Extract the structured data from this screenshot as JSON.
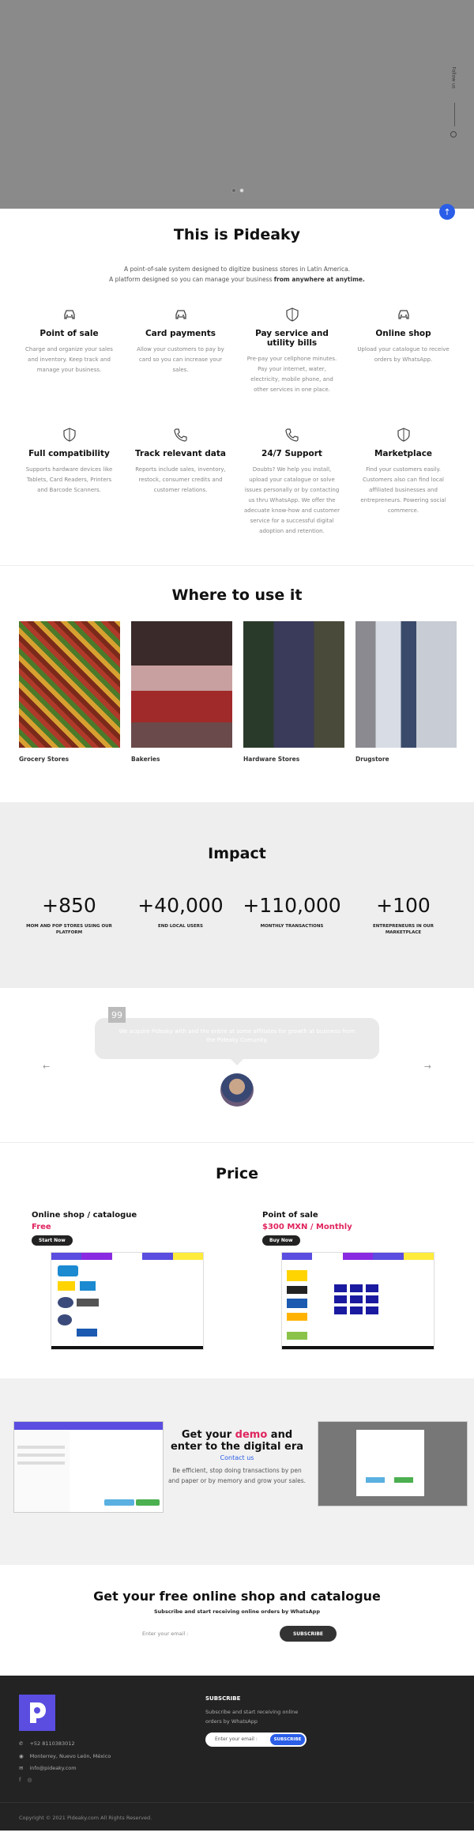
{
  "hero": {
    "follow_label": "Follow us",
    "slides": 2,
    "active_slide": 1
  },
  "about": {
    "title": "This is Pideaky",
    "line1": "A point-of-sale system designed to digitize business stores in Latin America.",
    "line2_prefix": "A platform designed so you can manage your business ",
    "line2_bold": "from anywhere at anytime.",
    "features": [
      {
        "icon": "car-icon",
        "title": "Point of sale",
        "desc": "Charge and organize your sales and inventory. Keep track and manage your business."
      },
      {
        "icon": "car-icon",
        "title": "Card payments",
        "desc": "Allow your customers to pay by card so you can increase your sales."
      },
      {
        "icon": "shield-icon",
        "title": "Pay service and utility bills",
        "desc": "Pre-pay your cellphone minutes. Pay your internet, water, electricity, mobile phone, and other services in one place."
      },
      {
        "icon": "car-icon",
        "title": "Online shop",
        "desc": "Upload your catalogue to receive orders by WhatsApp."
      },
      {
        "icon": "shield-icon",
        "title": "Full compatibility",
        "desc": "Supports hardware devices like Tablets, Card Readers, Printers and Barcode Scanners."
      },
      {
        "icon": "phone-icon",
        "title": "Track relevant data",
        "desc": "Reports include sales, inventory, restock, consumer credits and customer relations."
      },
      {
        "icon": "phone-icon",
        "title": "24/7 Support",
        "desc": "Doubts? We help you install, upload your catalogue or solve issues personally or by contacting us thru WhatsApp. We offer the adecuate know-how and customer service for a successful digital adoption and retention."
      },
      {
        "icon": "shield-icon",
        "title": "Marketplace",
        "desc": "Find your customers easily. Customers also can find local affiliated businesses and entrepreneurs. Powering social commerce."
      }
    ]
  },
  "where": {
    "title": "Where to use it",
    "items": [
      {
        "label": "Grocery Stores"
      },
      {
        "label": "Bakeries"
      },
      {
        "label": "Hardware Stores"
      },
      {
        "label": "Drugstore"
      }
    ]
  },
  "impact": {
    "title": "Impact",
    "stats": [
      {
        "num": "+850",
        "label": "MOM AND POP STORES USING OUR PLATFORM"
      },
      {
        "num": "+40,000",
        "label": "END LOCAL USERS"
      },
      {
        "num": "+110,000",
        "label": "MONTHLY TRANSACTIONS"
      },
      {
        "num": "+100",
        "label": "ENTREPRENEURS IN OUR MARKETPLACE"
      }
    ]
  },
  "testimonial": {
    "quote_mark": "99",
    "text": "We acquire Pideaky with and the entire at some affiliates for growth at business from the Pideaky Comunity."
  },
  "price": {
    "title": "Price",
    "plans": [
      {
        "name": "Online shop / catalogue",
        "price": "Free",
        "button": "Start Now"
      },
      {
        "name": "Point of sale",
        "price": "$300 MXN / Monthly",
        "button": "Buy Now"
      }
    ]
  },
  "digital": {
    "title_a": "Get your ",
    "title_red": "demo",
    "title_b": " and enter to the digital era",
    "contact": "Contact us",
    "text": "Be efficient, stop doing transactions by pen and paper or by memory and grow your sales."
  },
  "cta": {
    "title": "Get your free online shop and catalogue",
    "subtitle": "Subscribe and start receiving online orders by WhatsApp",
    "placeholder": "Enter your email :",
    "button": "SUBSCRIBE"
  },
  "footer": {
    "phone": "+52 8110383012",
    "address": "Monterrey, Nuevo León, México",
    "email": "info@pideaky.com",
    "subscribe_title": "SUBSCRIBE",
    "subscribe_text": "Subscribe and start receiving online orders by WhatsApp",
    "email_placeholder": "Enter your email :",
    "email_button": "SUBSCRIBE",
    "copyright": "Copyright © 2021 Pideaky.com All Rights Reserved."
  },
  "colors": {
    "accent": "#2a5ee8",
    "brand": "#5a4de0",
    "highlight": "#e0245e"
  }
}
